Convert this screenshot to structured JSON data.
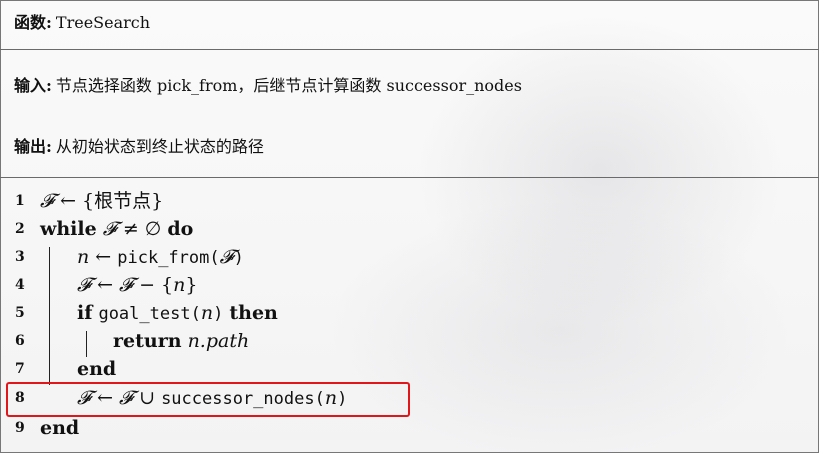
{
  "header": {
    "function_label": "函数:",
    "function_name": "TreeSearch",
    "input_label": "输入:",
    "input_text": "节点选择函数 pick_from，后继节点计算函数 successor_nodes",
    "output_label": "输出:",
    "output_text": "从初始状态到终止状态的路径"
  },
  "algorithm": {
    "lines": [
      {
        "num": "1",
        "root_label": "根节点"
      },
      {
        "num": "2",
        "while": "while",
        "do": "do"
      },
      {
        "num": "3",
        "var_n": "n",
        "pick_call": "pick_from"
      },
      {
        "num": "4",
        "var_n": "n"
      },
      {
        "num": "5",
        "if": "if",
        "goal_call": "goal_test",
        "var_n": "n",
        "then": "then"
      },
      {
        "num": "6",
        "return": "return",
        "path_expr": "n.path"
      },
      {
        "num": "7",
        "end": "end"
      },
      {
        "num": "8",
        "succ_call": "successor_nodes",
        "var_n": "n"
      },
      {
        "num": "9",
        "end": "end"
      }
    ],
    "highlighted_line": "8",
    "highlight_color": "#e0161a"
  }
}
